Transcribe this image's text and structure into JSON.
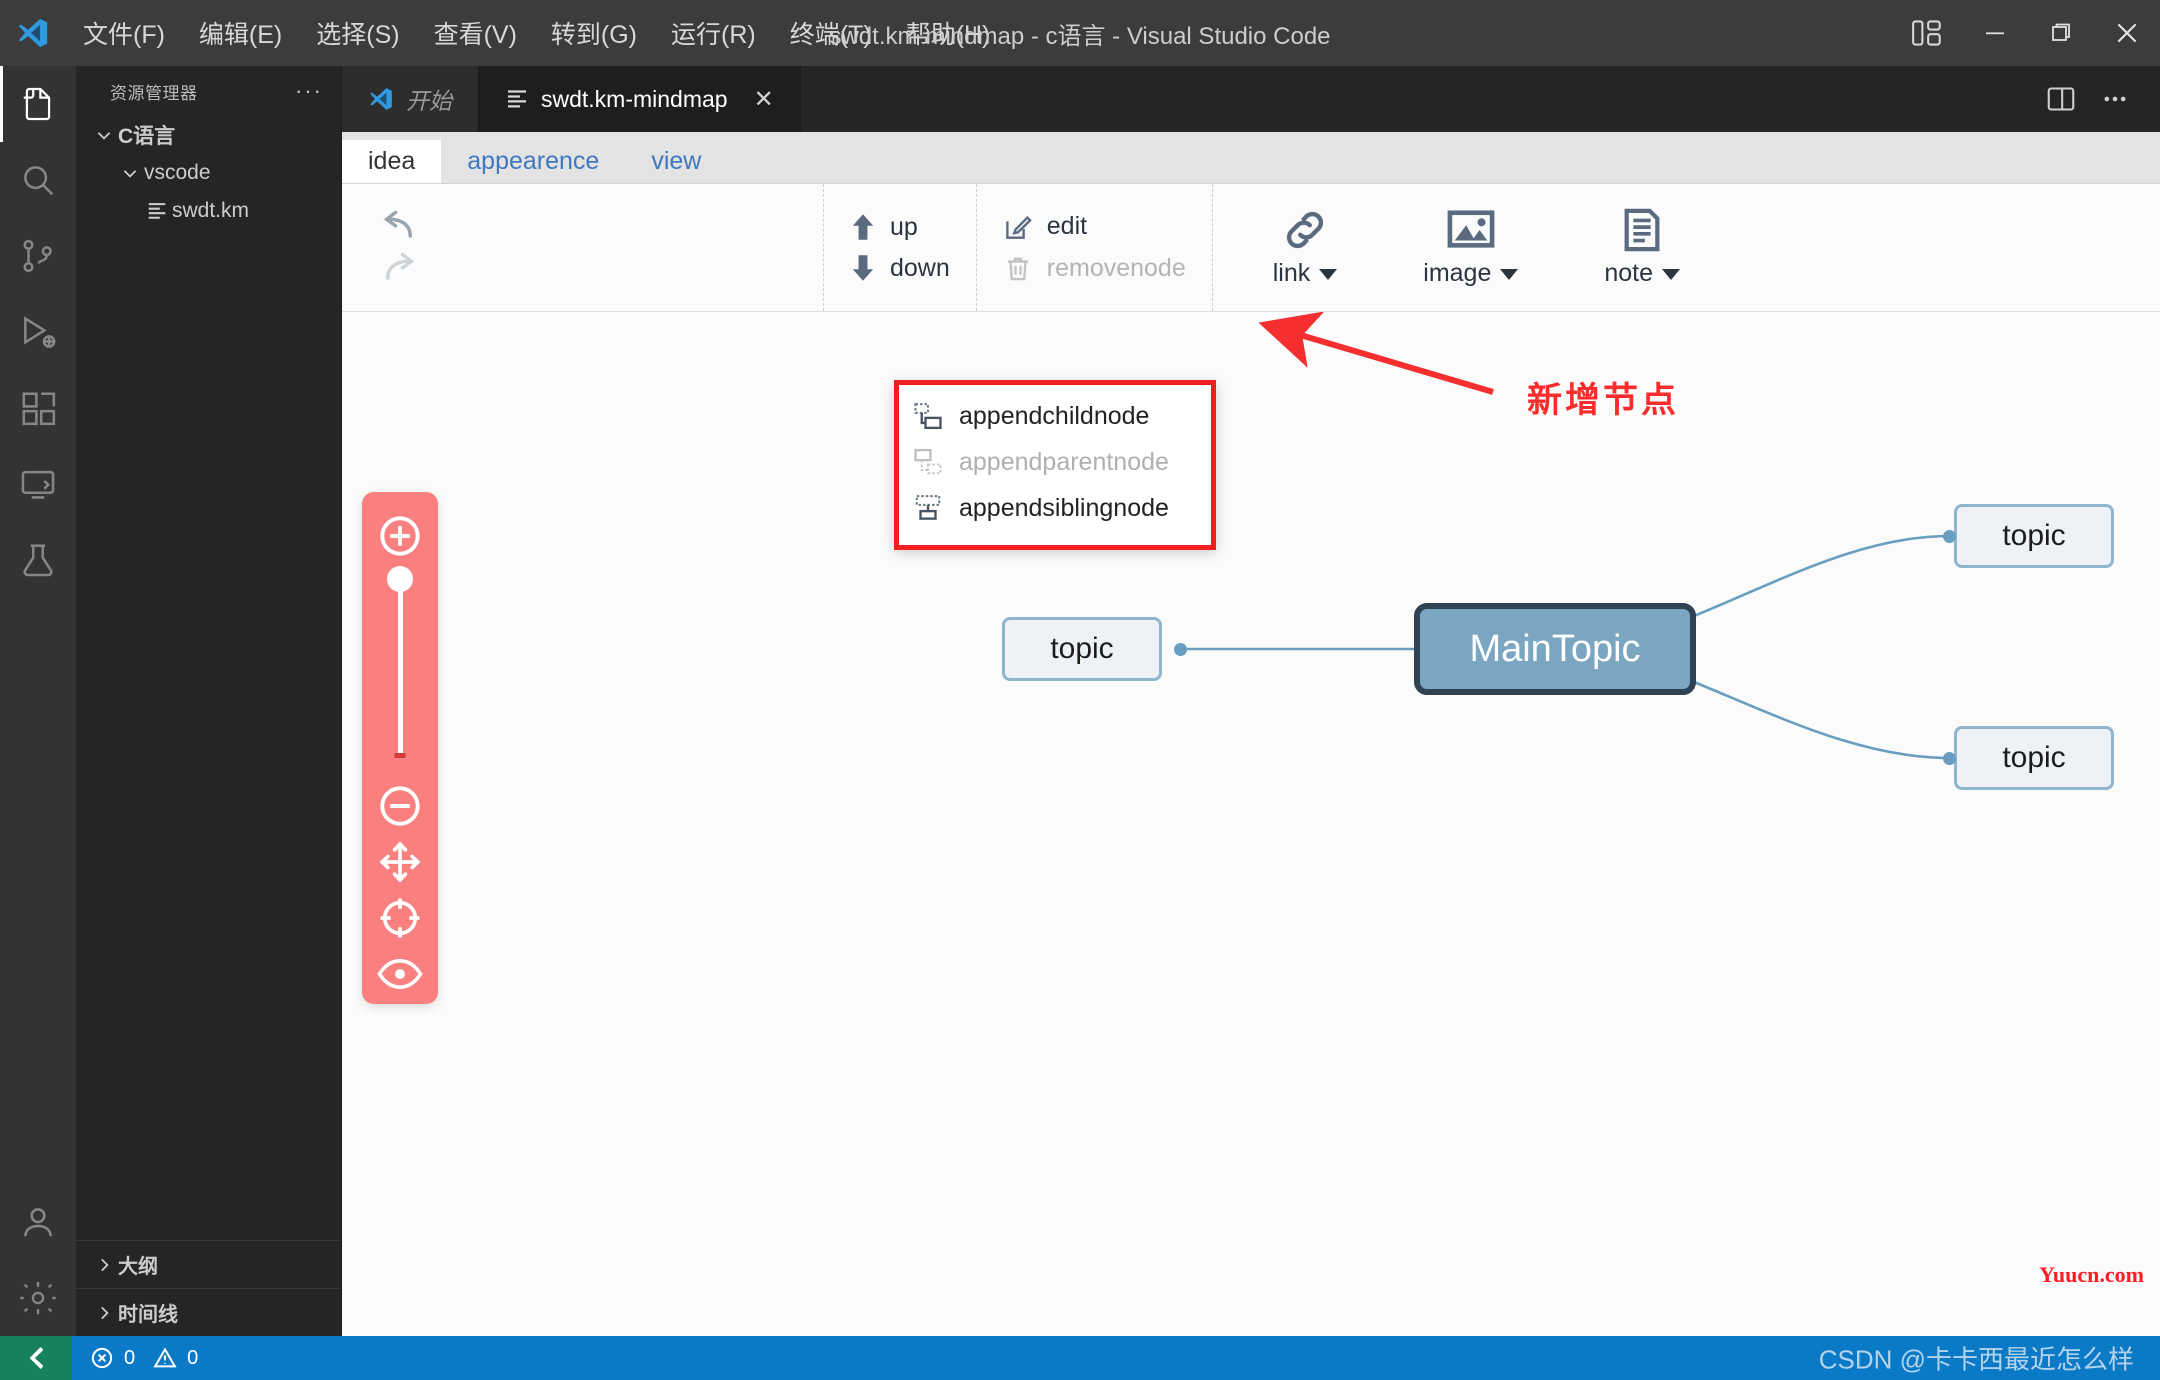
{
  "window": {
    "title": "swdt.km-mindmap - c语言 - Visual Studio Code",
    "menu": [
      "文件(F)",
      "编辑(E)",
      "选择(S)",
      "查看(V)",
      "转到(G)",
      "运行(R)",
      "终端(T)",
      "帮助(H)"
    ],
    "controls": {
      "minimize": "—",
      "maximize": "❐",
      "close": "✕"
    }
  },
  "activitybar": {
    "items": [
      {
        "name": "explorer",
        "label": "资源管理器"
      },
      {
        "name": "search",
        "label": "搜索"
      },
      {
        "name": "source-control",
        "label": "源代码管理"
      },
      {
        "name": "run-debug",
        "label": "运行和调试"
      },
      {
        "name": "extensions",
        "label": "扩展"
      },
      {
        "name": "remote-explorer",
        "label": "远程资源管理器"
      },
      {
        "name": "test",
        "label": "测试"
      },
      {
        "name": "account",
        "label": "账户"
      },
      {
        "name": "settings",
        "label": "管理"
      }
    ]
  },
  "sidebar": {
    "title": "资源管理器",
    "more": "···",
    "tree": [
      {
        "label": "C语言",
        "level": 0,
        "expanded": true,
        "type": "folder"
      },
      {
        "label": "vscode",
        "level": 1,
        "expanded": true,
        "type": "folder"
      },
      {
        "label": "swdt.km",
        "level": 2,
        "expanded": false,
        "type": "file"
      }
    ],
    "panels": [
      {
        "label": "大纲",
        "expanded": false
      },
      {
        "label": "时间线",
        "expanded": false
      }
    ]
  },
  "tabs": {
    "items": [
      {
        "label": "开始",
        "icon": "vscode-logo-icon",
        "active": false,
        "preview": true,
        "closable": false
      },
      {
        "label": "swdt.km-mindmap",
        "icon": "file-lines-icon",
        "active": true,
        "preview": false,
        "closable": true
      }
    ],
    "close_glyph": "✕",
    "actions": [
      "split-editor-icon",
      "more-actions-icon"
    ]
  },
  "mindmap_toolbar": {
    "tabs": [
      {
        "label": "idea",
        "active": true
      },
      {
        "label": "appearence",
        "active": false
      },
      {
        "label": "view",
        "active": false
      }
    ],
    "history": [
      {
        "name": "undo",
        "label": "undo",
        "enabled": true
      },
      {
        "name": "redo",
        "label": "redo",
        "enabled": false
      }
    ],
    "append_menu": {
      "open": true,
      "highlighted": true,
      "items": [
        {
          "label": "appendchildnode",
          "enabled": true,
          "icon": "append-child-icon"
        },
        {
          "label": "appendparentnode",
          "enabled": false,
          "icon": "append-parent-icon"
        },
        {
          "label": "appendsiblingnode",
          "enabled": true,
          "icon": "append-sibling-icon"
        }
      ]
    },
    "move_group": [
      {
        "label": "up",
        "enabled": true,
        "icon": "arrow-up-icon"
      },
      {
        "label": "down",
        "enabled": true,
        "icon": "arrow-down-icon"
      }
    ],
    "edit_group": [
      {
        "label": "edit",
        "enabled": true,
        "icon": "edit-pencil-icon"
      },
      {
        "label": "removenode",
        "enabled": false,
        "icon": "trash-icon"
      }
    ],
    "insert_group": [
      {
        "label": "link",
        "icon": "link-chain-icon",
        "has_dropdown": true
      },
      {
        "label": "image",
        "icon": "image-picture-icon",
        "has_dropdown": true
      },
      {
        "label": "note",
        "icon": "note-document-icon",
        "has_dropdown": true
      }
    ]
  },
  "annotation": {
    "text": "新增节点",
    "color": "#fb2c2c"
  },
  "mindmap": {
    "main_node": {
      "label": "MainTopic",
      "fill": "#7aa6c2",
      "border": "#2f4355",
      "text": "#ffffff"
    },
    "child_nodes": [
      {
        "label": "topic",
        "position": "left"
      },
      {
        "label": "topic",
        "position": "right-top"
      },
      {
        "label": "topic",
        "position": "right-bottom"
      }
    ],
    "node_fill": "#eef2f6",
    "node_border": "#8fb4cd",
    "link_color": "#6a9ec0"
  },
  "zoom_panel": {
    "background": "#f9807e",
    "controls": [
      {
        "name": "zoom-in-icon",
        "label": "zoom in"
      },
      {
        "name": "zoom-slider",
        "label": "zoom level"
      },
      {
        "name": "zoom-out-icon",
        "label": "zoom out"
      },
      {
        "name": "move-icon",
        "label": "pan"
      },
      {
        "name": "center-icon",
        "label": "center"
      },
      {
        "name": "eye-icon",
        "label": "visibility"
      }
    ]
  },
  "statusbar": {
    "remote_icon": "remote-window-icon",
    "errors": "0",
    "warnings": "0",
    "watermark": "CSDN @卡卡西最近怎么样"
  },
  "watermark_red": "Yuucn.com"
}
